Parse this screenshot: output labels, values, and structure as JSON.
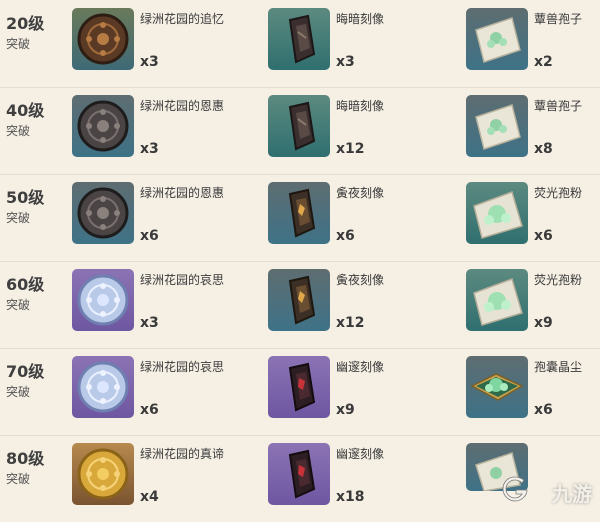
{
  "rows": [
    {
      "level": "20级",
      "sub": "突破",
      "items": [
        {
          "name": "绿洲花园的追忆",
          "qty": "x3",
          "icon": "brown-medallion-icon"
        },
        {
          "name": "晦暗刻像",
          "qty": "x3",
          "icon": "dark-carving-icon"
        },
        {
          "name": "蕈兽孢子",
          "qty": "x2",
          "icon": "spore-packet-icon"
        }
      ]
    },
    {
      "level": "40级",
      "sub": "突破",
      "items": [
        {
          "name": "绿洲花园的恩惠",
          "qty": "x3",
          "icon": "dark-medallion-icon"
        },
        {
          "name": "晦暗刻像",
          "qty": "x12",
          "icon": "dark-carving-icon"
        },
        {
          "name": "蕈兽孢子",
          "qty": "x8",
          "icon": "spore-packet-icon"
        }
      ]
    },
    {
      "level": "50级",
      "sub": "突破",
      "items": [
        {
          "name": "绿洲花园的恩惠",
          "qty": "x6",
          "icon": "dark-medallion-icon"
        },
        {
          "name": "夤夜刻像",
          "qty": "x6",
          "icon": "gold-carving-icon"
        },
        {
          "name": "荧光孢粉",
          "qty": "x6",
          "icon": "glow-spore-icon"
        }
      ]
    },
    {
      "level": "60级",
      "sub": "突破",
      "items": [
        {
          "name": "绿洲花园的哀思",
          "qty": "x3",
          "icon": "blue-medallion-icon"
        },
        {
          "name": "夤夜刻像",
          "qty": "x12",
          "icon": "gold-carving-icon"
        },
        {
          "name": "荧光孢粉",
          "qty": "x9",
          "icon": "glow-spore-icon"
        }
      ]
    },
    {
      "level": "70级",
      "sub": "突破",
      "items": [
        {
          "name": "绿洲花园的哀思",
          "qty": "x6",
          "icon": "blue-medallion-icon"
        },
        {
          "name": "幽邃刻像",
          "qty": "x9",
          "icon": "red-carving-icon"
        },
        {
          "name": "孢囊晶尘",
          "qty": "x6",
          "icon": "crystal-dust-icon"
        }
      ]
    },
    {
      "level": "80级",
      "sub": "突破",
      "items": [
        {
          "name": "绿洲花园的真谛",
          "qty": "x4",
          "icon": "gold-medallion-icon"
        },
        {
          "name": "幽邃刻像",
          "qty": "x18",
          "icon": "red-carving-icon"
        },
        {
          "name": "",
          "qty": "",
          "icon": "spore-packet-icon"
        }
      ]
    }
  ],
  "watermark": {
    "text": "九游",
    "icon": "jiuyou-logo-icon"
  }
}
